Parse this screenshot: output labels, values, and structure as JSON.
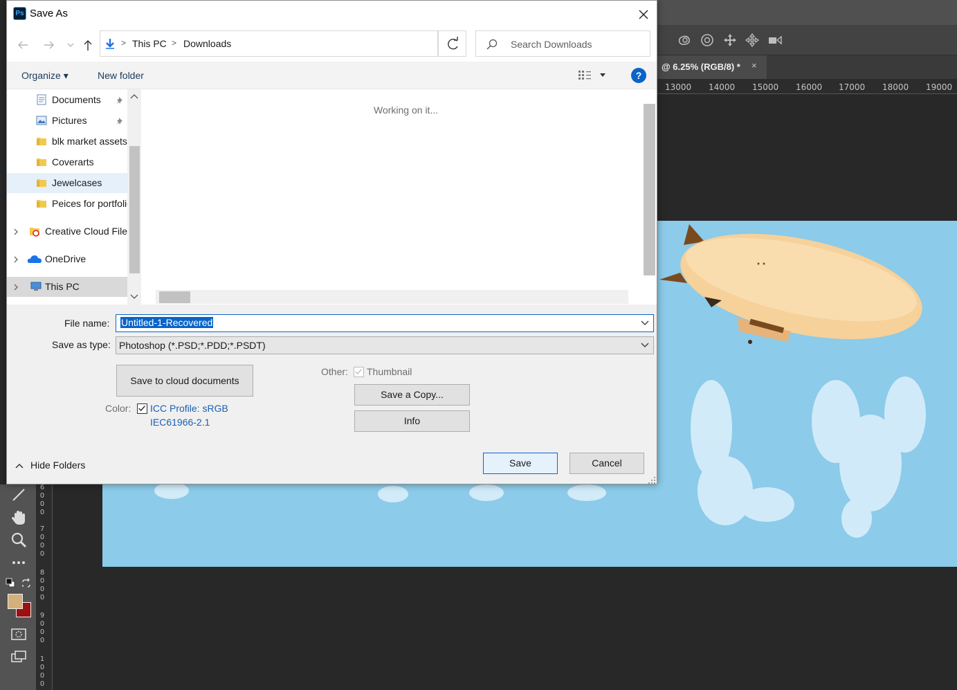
{
  "photoshop": {
    "document_tab": "@ 6.25% (RGB/8) *",
    "tab_close": "×",
    "ruler_top": [
      "13000",
      "14000",
      "15000",
      "16000",
      "17000",
      "18000",
      "19000"
    ],
    "ruler_left": [
      "6",
      "0",
      "0",
      "0",
      "7",
      "0",
      "0",
      "0",
      "8",
      "0",
      "0",
      "0",
      "9",
      "0",
      "0",
      "0",
      "1",
      "0",
      "0",
      "0"
    ],
    "foreground_color": "#d4b07a",
    "background_color": "#9b1111",
    "canvas_color": "#8ccbe9",
    "options_icons": [
      "orbit-3d-icon",
      "roll-3d-icon",
      "pan-3d-icon",
      "slide-3d-icon",
      "scale-3d-icon"
    ],
    "tools": [
      "line-tool-icon",
      "hand-tool-icon",
      "zoom-tool-icon",
      "more-tools-icon",
      "default-colors-icon",
      "swap-colors-icon",
      "quick-mask-icon",
      "screen-mode-icon"
    ]
  },
  "dialog": {
    "app_icon": "Ps",
    "title": "Save As",
    "close": "×",
    "address": {
      "segments": [
        "This PC",
        "Downloads"
      ]
    },
    "search_placeholder": "Search Downloads",
    "commands": {
      "organize": "Organize ▾",
      "new_folder": "New folder",
      "help": "?"
    },
    "nav": {
      "items": [
        {
          "label": "Documents",
          "icon": "documents-icon",
          "pinned": true
        },
        {
          "label": "Pictures",
          "icon": "pictures-icon",
          "pinned": true
        },
        {
          "label": "blk market assets",
          "icon": "folder-icon",
          "pinned": false
        },
        {
          "label": "Coverarts",
          "icon": "folder-icon",
          "pinned": false
        },
        {
          "label": "Jewelcases",
          "icon": "folder-icon",
          "pinned": false,
          "selected": true
        },
        {
          "label": "Peices for portfolio",
          "icon": "folder-icon",
          "pinned": false
        },
        {
          "label": "Creative Cloud Files",
          "icon": "creative-cloud-folder-icon",
          "expandable": true
        },
        {
          "label": "OneDrive",
          "icon": "onedrive-icon",
          "expandable": true
        },
        {
          "label": "This PC",
          "icon": "this-pc-icon",
          "expandable": true
        }
      ]
    },
    "file_pane": {
      "status": "Working on it..."
    },
    "form": {
      "file_name_label": "File name:",
      "file_name_value": "Untitled-1-Recovered",
      "save_type_label": "Save as type:",
      "save_type_value": "Photoshop (*.PSD;*.PDD;*.PSDT)"
    },
    "options": {
      "cloud_button": "Save to cloud documents",
      "other_label": "Other:",
      "thumbnail_label": "Thumbnail",
      "thumbnail_checked": true,
      "save_copy_button": "Save a Copy...",
      "info_button": "Info",
      "color_label": "Color:",
      "icc_profile_line1": "ICC Profile:  sRGB",
      "icc_profile_line2": "IEC61966-2.1",
      "icc_checked": true
    },
    "footer": {
      "hide_folders": "Hide Folders",
      "save": "Save",
      "cancel": "Cancel"
    }
  }
}
